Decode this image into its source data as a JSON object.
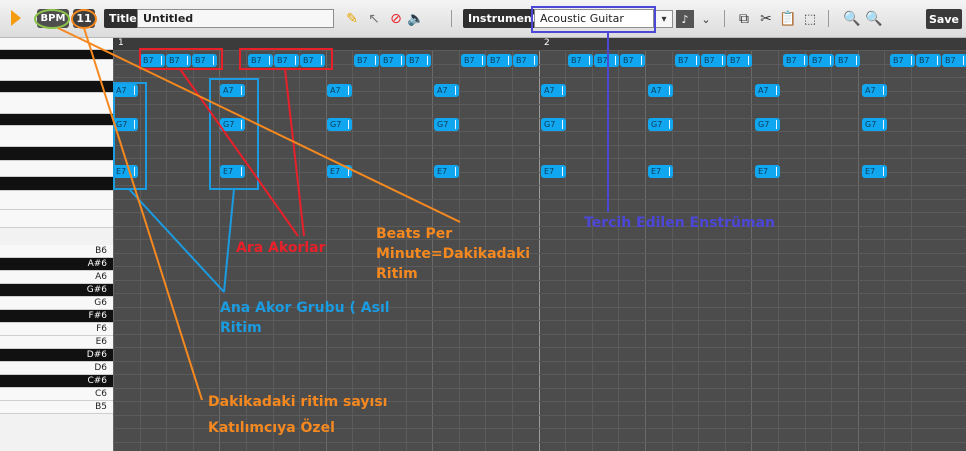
{
  "toolbar": {
    "bpm_label": "BPM",
    "bpm_value": "11",
    "title_label": "Title",
    "title_value": "Untitled",
    "instrument_label": "Instrument",
    "instrument_value": "Acoustic Guitar",
    "save_label": "Save",
    "icons": [
      "pencil-icon",
      "pointer-icon",
      "delete-icon",
      "speaker-icon",
      "dropdown-arrow-icon",
      "instrument-picker-icon",
      "copy-icon",
      "cut-icon",
      "paste-icon",
      "select-icon",
      "zoom-out-icon",
      "zoom-in-icon"
    ]
  },
  "ruler": {
    "bars": [
      "1",
      "2"
    ]
  },
  "piano_keys": [
    "B6",
    "A#6",
    "A6",
    "G#6",
    "G6",
    "F#6",
    "F6",
    "E6",
    "D#6",
    "D6",
    "C#6",
    "C6",
    "B5"
  ],
  "chords": {
    "top_row": "B7",
    "row_a": "A7",
    "row_g": "G7",
    "row_e": "E7"
  },
  "annotations": {
    "ara_akorlar": "Ara Akorlar",
    "beats_per_minute": [
      "Beats Per",
      "Minute=Dakikadaki",
      "Ritim"
    ],
    "ana_akor": [
      "Ana Akor Grubu ( Asıl",
      "Ritim"
    ],
    "dakikadaki": [
      "Dakikadaki ritim sayısı",
      "Katılımcıya Özel"
    ],
    "tercih": "Tercih Edilen Enstrüman"
  },
  "colors": {
    "red": "#e8202a",
    "orange": "#f5891f",
    "blue": "#1b9be0",
    "purple": "#4c47d6",
    "green": "#8bc34a",
    "chip": "#10a7f0"
  }
}
